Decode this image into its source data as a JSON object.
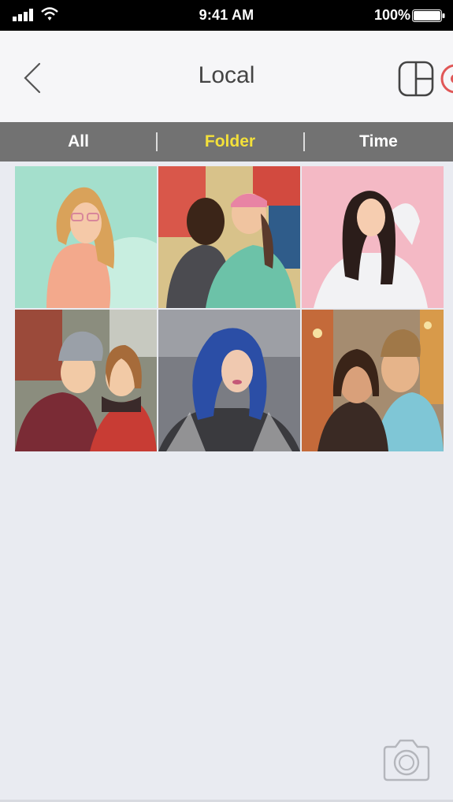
{
  "status_bar": {
    "time": "9:41 AM",
    "battery_percent": "100%",
    "icons": [
      "signal-icon",
      "wifi-icon",
      "battery-icon"
    ]
  },
  "nav": {
    "title": "Local",
    "back_icon": "chevron-left-icon",
    "collage_icon": "collage-layout-icon"
  },
  "tabs": [
    {
      "label": "All",
      "active": false
    },
    {
      "label": "Folder",
      "active": true
    },
    {
      "label": "Time",
      "active": false
    }
  ],
  "colors": {
    "accent": "#f3e03a",
    "tab_bar": "#727272",
    "background": "#e9ebf1"
  },
  "photos": [
    {
      "name": "woman-with-balloon",
      "bg": "#9fdcc6"
    },
    {
      "name": "couple-hugging",
      "bg": "#c9b48a"
    },
    {
      "name": "woman-pink-wall",
      "bg": "#f3b8c4"
    },
    {
      "name": "two-friends-winter",
      "bg": "#8d8f84"
    },
    {
      "name": "blue-hair-woman",
      "bg": "#7d7f86"
    },
    {
      "name": "couple-selfie-city",
      "bg": "#b8a58d"
    }
  ],
  "camera_icon": "camera-icon"
}
